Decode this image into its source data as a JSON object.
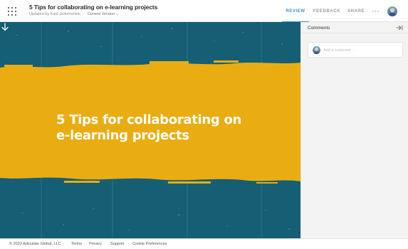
{
  "header": {
    "menu_icon": "grid-icon",
    "title": "5 Tips for collaborating on e-learning projects",
    "updated_by": "Updated by Kate Golomshtok",
    "version": "Current Version",
    "version_icon": "chevron-down-icon",
    "tabs": [
      {
        "label": "REVIEW",
        "active": true
      },
      {
        "label": "FEEDBACK",
        "active": false
      },
      {
        "label": "SHARE",
        "active": false
      }
    ],
    "more_label": "···",
    "accent_color": "#3b8fd9"
  },
  "slide": {
    "title_line1": "5 Tips for collaborating on",
    "title_line2": "e-learning projects",
    "background_color": "#155e74",
    "banner_color": "#e9ad12",
    "next_icon": "arrow-down-icon"
  },
  "comments": {
    "title": "Comments",
    "collapse_icon": "collapse-panel-icon",
    "placeholder": "Add a comment…",
    "value": ""
  },
  "footer": {
    "copyright": "© 2023 Articulate Global, LLC",
    "links": [
      "Terms",
      "Privacy",
      "Support",
      "Cookie Preferences"
    ]
  }
}
